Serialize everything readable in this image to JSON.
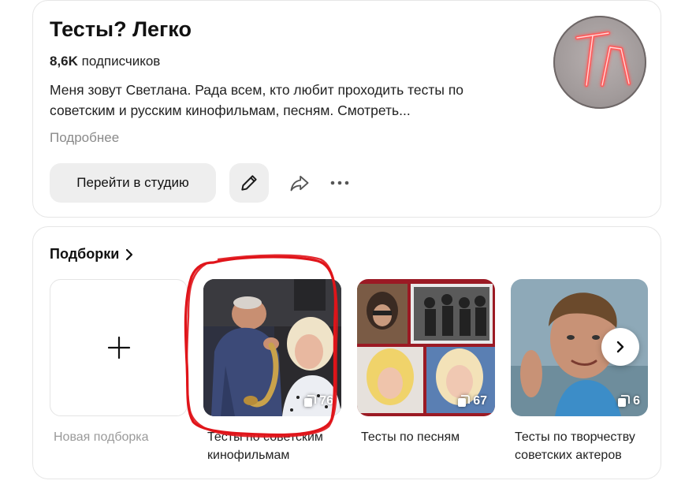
{
  "profile": {
    "title": "Тесты? Легко",
    "subscribers_count": "8,6K",
    "subscribers_word": "подписчиков",
    "description": "Меня зовут Светлана. Рада всем, кто любит проходить тесты по советским и русским кинофильмам, песням. Смотреть...",
    "more_label": "Подробнее",
    "avatar_letters": "ТЛ",
    "studio_button": "Перейти в студию",
    "icons": {
      "edit": "pencil-icon",
      "share": "share-arrow-icon",
      "more": "more-dots-icon"
    }
  },
  "collections": {
    "section_title": "Подборки",
    "new_label": "Новая подборка",
    "items": [
      {
        "label": "Тесты по советским кинофильмам",
        "count": "76"
      },
      {
        "label": "Тесты по песням",
        "count": "67"
      },
      {
        "label": "Тесты по творчеству советских актеров",
        "count": "6"
      }
    ]
  },
  "colors": {
    "button_bg": "#eeeeee",
    "annotation_red": "#e0141a",
    "muted_text": "#8a8a8a",
    "avatar_neon": "#ff5a5a"
  }
}
